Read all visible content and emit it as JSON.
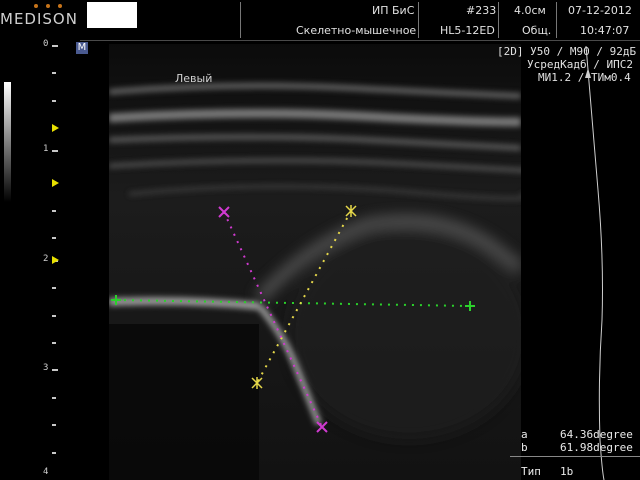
{
  "header": {
    "brand": "MEDISON",
    "center_line1": "ИП БиС",
    "center_line2": "Скелетно-мышечное",
    "frame_number": "#233",
    "probe": "HL5-12ED",
    "depth": "4.0см",
    "preset": "Общ.",
    "date": "07-12-2012",
    "time": "10:47:07"
  },
  "mode_badge": "M",
  "depth_scale": [
    "0",
    "1",
    "2",
    "3",
    "4"
  ],
  "image": {
    "side_label": "Левый"
  },
  "params": {
    "line1": "[2D] У50 / М90 / 92дБ",
    "line2": "УсредКадб / ИПС2 /",
    "line3": "МИ1.2 / ТИм0.4"
  },
  "measurements": {
    "a_label": "a",
    "a_value": "64.36degree",
    "b_label": "b",
    "b_value": "61.98degree",
    "type_label": "Тип",
    "type_value": "1b"
  },
  "colors": {
    "baseline": "#2bd12b",
    "line_a": "#e6d84a",
    "line_b": "#d03ad0",
    "focus_marker": "#e8e000"
  }
}
